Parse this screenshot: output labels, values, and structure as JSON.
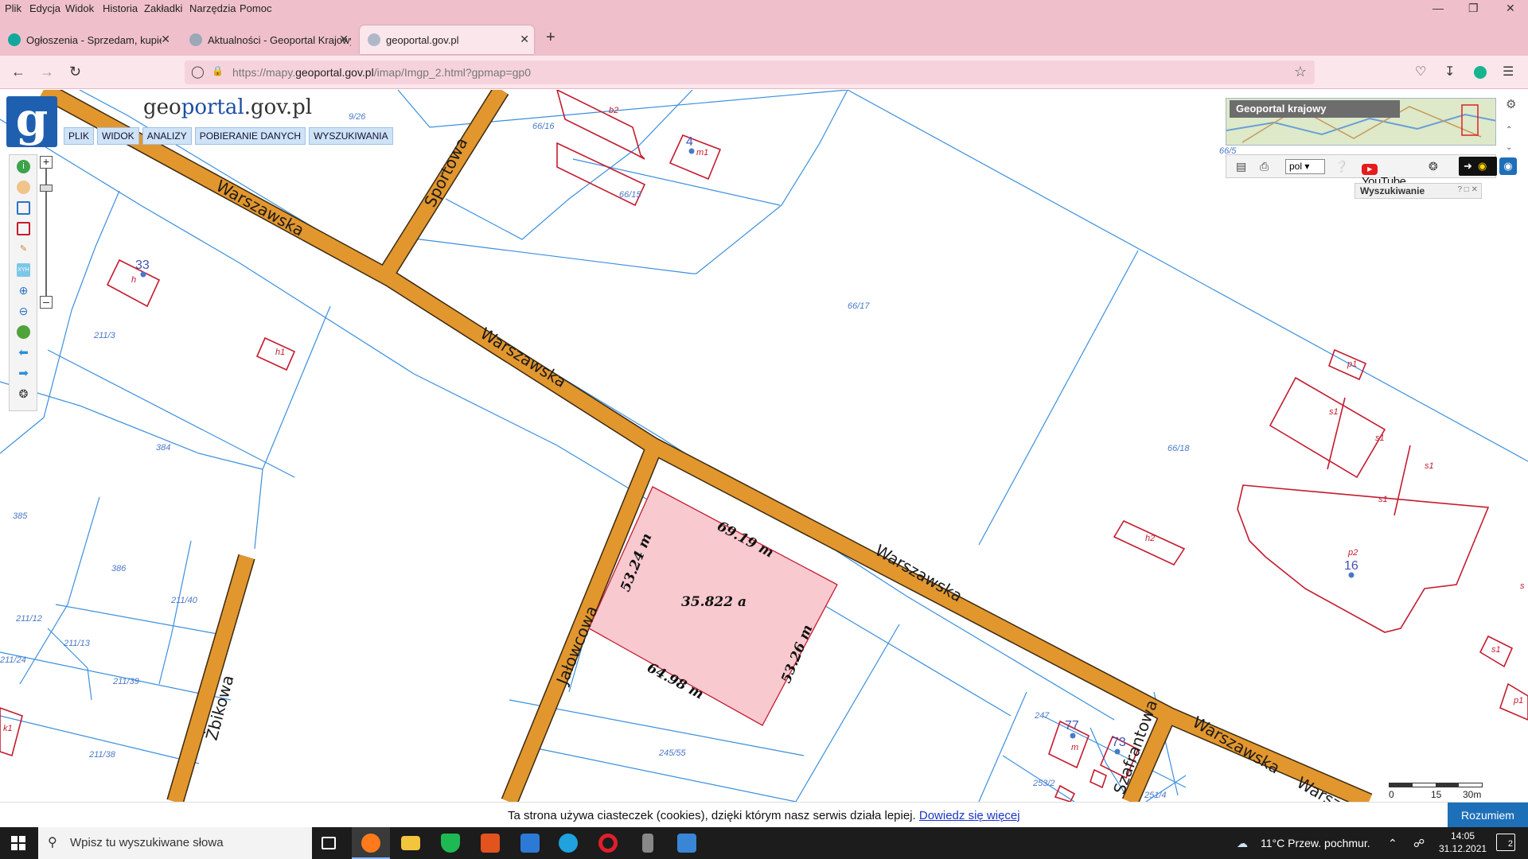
{
  "browser": {
    "menu": [
      "Plik",
      "Edycja",
      "Widok",
      "Historia",
      "Zakładki",
      "Narzędzia",
      "Pomoc"
    ],
    "tabs": [
      {
        "title": "Ogłoszenia - Sprzedam, kupię n",
        "favicon_color": "#13a89e"
      },
      {
        "title": "Aktualności - Geoportal Krajowy",
        "favicon_color": "#9aa8b8"
      },
      {
        "title": "geoportal.gov.pl",
        "favicon_color": "#b0b8c8",
        "active": true
      }
    ],
    "url_prefix": "https://mapy.",
    "url_host": "geoportal.gov.pl",
    "url_suffix": "/imap/Imgp_2.html?gpmap=gp0"
  },
  "portal": {
    "logo_letter": "g",
    "brand_geo": "geo",
    "brand_portal": "portal",
    "brand_domain": ".gov.pl",
    "menu": [
      "PLIK",
      "WIDOK",
      "ANALIZY",
      "POBIERANIE DANYCH",
      "WYSZUKIWANIA"
    ],
    "overview_title": "Geoportal krajowy",
    "language": "pol",
    "youtube_label": "YouTube",
    "search_panel_title": "Wyszukiwanie",
    "scale_labels": [
      "0",
      "15",
      "30m"
    ]
  },
  "map": {
    "streets": [
      "Warszawska",
      "Warszawska",
      "Warszawska",
      "Warszawska",
      "Warszawska",
      "Sportowa",
      "Jałowcowa",
      "Żbikowa",
      "Szafrantowa"
    ],
    "parcels": [
      "66/16",
      "66/15",
      "66/17",
      "66/18",
      "66/5",
      "211/3",
      "384",
      "385",
      "386",
      "211/40",
      "211/12",
      "211/13",
      "211/24",
      "211/39",
      "211/38",
      "245/55",
      "247",
      "251/4",
      "253/2",
      "9/26"
    ],
    "buildings": [
      "b2",
      "m1",
      "h",
      "h1",
      "p1",
      "s1",
      "s1",
      "s1",
      "s1",
      "h2",
      "p2",
      "s1",
      "p1",
      "k1",
      "m",
      "s"
    ],
    "address_numbers": [
      "4",
      "33",
      "16",
      "77",
      "73"
    ],
    "selection": {
      "area": "35.822 a",
      "edges": [
        "69.19 m",
        "53.24 m",
        "53.26 m",
        "64.98 m"
      ]
    },
    "colors": {
      "road": "#e2962e",
      "parcel_line": "#3b8fde",
      "building": "#c41b2e",
      "selection_fill": "#f8c9cf"
    }
  },
  "cookie": {
    "text": "Ta strona używa ciasteczek (cookies), dzięki którym nasz serwis działa lepiej.",
    "link": "Dowiedz się więcej",
    "button": "Rozumiem"
  },
  "taskbar": {
    "search_placeholder": "Wpisz tu wyszukiwane słowa",
    "weather": "11°C  Przew. pochmur.",
    "time": "14:05",
    "date": "31.12.2021",
    "notifications": "2"
  }
}
